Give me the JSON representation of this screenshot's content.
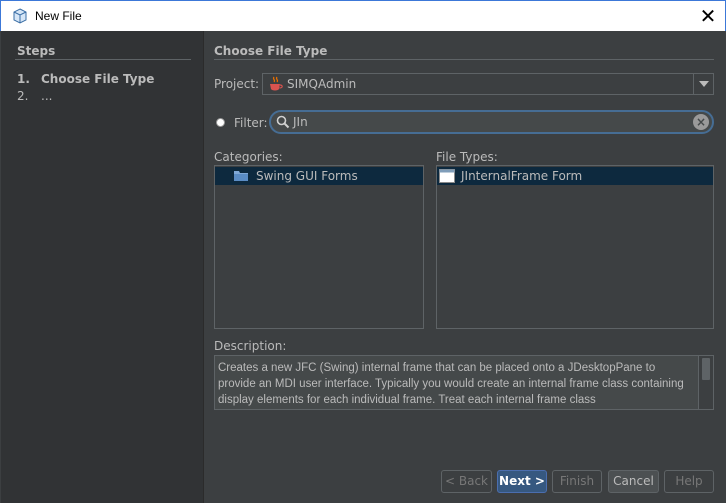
{
  "window": {
    "title": "New File",
    "icon": "netbeans-cube-icon"
  },
  "steps": {
    "heading": "Steps",
    "items": [
      {
        "num": "1.",
        "label": "Choose File Type"
      },
      {
        "num": "2.",
        "label": "..."
      }
    ]
  },
  "main": {
    "heading": "Choose File Type"
  },
  "project": {
    "label": "Project:",
    "value": "SIMQAdmin",
    "icon": "java-cup-icon"
  },
  "filter": {
    "label": "Filter:",
    "value": "JIn"
  },
  "categories": {
    "label": "Categories:",
    "items": [
      {
        "label": "Swing GUI Forms",
        "icon": "folder-icon",
        "selected": true
      }
    ]
  },
  "file_types": {
    "label": "File Types:",
    "items": [
      {
        "label": "JInternalFrame Form",
        "icon": "window-form-icon",
        "selected": true
      }
    ]
  },
  "description": {
    "label": "Description:",
    "text": "Creates a new JFC (Swing) internal frame that can be placed onto a JDesktopPane to provide an MDI user interface. Typically you would create an internal frame class containing display elements for each individual frame. Treat each internal frame class"
  },
  "buttons": {
    "back": "< Back",
    "next": "Next >",
    "finish": "Finish",
    "cancel": "Cancel",
    "help": "Help"
  },
  "colors": {
    "background": "#3c3f41",
    "steps_panel": "#313335",
    "selection": "#0d293e",
    "accent": "#466d94"
  }
}
